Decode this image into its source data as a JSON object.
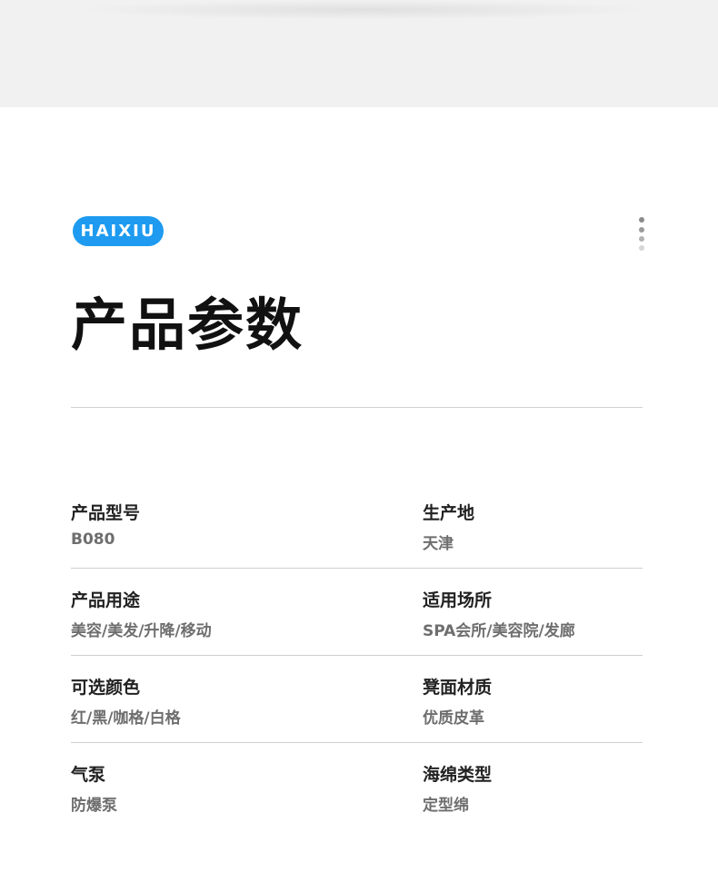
{
  "brand": {
    "logo_text": "HAIXIU",
    "color": "#1e9bf0"
  },
  "header": {
    "title": "产品参数",
    "menu_icon": "more-vertical-dots-icon"
  },
  "specs": [
    {
      "left": {
        "label": "产品型号",
        "value": "B080"
      },
      "right": {
        "label": "生产地",
        "value": "天津"
      }
    },
    {
      "left": {
        "label": "产品用途",
        "value": "美容/美发/升降/移动"
      },
      "right": {
        "label": "适用场所",
        "value": "SPA会所/美容院/发廊"
      }
    },
    {
      "left": {
        "label": "可选颜色",
        "value": "红/黑/咖格/白格"
      },
      "right": {
        "label": "凳面材质",
        "value": "优质皮革"
      }
    },
    {
      "left": {
        "label": "气泵",
        "value": "防爆泵"
      },
      "right": {
        "label": "海绵类型",
        "value": "定型绵"
      }
    }
  ]
}
